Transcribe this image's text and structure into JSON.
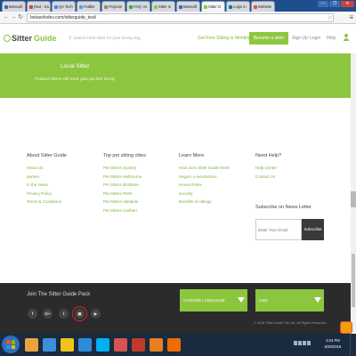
{
  "browser": {
    "tabs": [
      {
        "label": "Betasoft",
        "fav": "#3b6db0"
      },
      {
        "label": "(Nat - Gu",
        "fav": "#c9443a"
      },
      {
        "label": "QA Tech",
        "fav": "#4285f4"
      },
      {
        "label": "Fiddler",
        "fav": "#5b9bd5"
      },
      {
        "label": "Projects",
        "fav": "#888888"
      },
      {
        "label": "FAQ: Av",
        "fav": "#34a853"
      },
      {
        "label": "Sitter G",
        "fav": "#8cc63f"
      },
      {
        "label": "Betasoft",
        "fav": "#3b6db0"
      },
      {
        "label": "Sitter G",
        "fav": "#8cc63f",
        "active": true
      },
      {
        "label": "Login in",
        "fav": "#0077b5"
      },
      {
        "label": "Website",
        "fav": "#d9534f"
      }
    ],
    "url": "betasofsdev.com/sitterguide_test/",
    "window_buttons": {
      "minimize": "—",
      "maximize": "❐",
      "close": "✕"
    }
  },
  "header": {
    "logo_sitter": "Sitter",
    "logo_guide": "Guide",
    "search_placeholder": "Search here sitter for your loving dog",
    "get_free": "Get Free Sitting or Minding",
    "become_sitter": "Become a sitter",
    "sign_up": "Sign Up",
    "login": "Login",
    "help": "Help"
  },
  "hero": {
    "title": "Local Sitter",
    "subtitle": "Trusted sitters will treat your pet like family"
  },
  "footer": {
    "columns": [
      {
        "title": "About Sitter Guide",
        "items": [
          "About Us",
          "partner",
          "In the News",
          "Privacy Policy",
          "Terms & Conditions"
        ]
      },
      {
        "title": "Top pet sitting cities",
        "items": [
          "Pet Sitters Sydney",
          "Pet Sitters Melbourne",
          "Pet Sitters Brisbane",
          "Pet Sitters Perth",
          "Pet Sitters Adelaide",
          "Pet Sitters Canberr"
        ]
      },
      {
        "title": "Learn More",
        "items": [
          "How does Sitter Guide Work",
          "Seguro y reembolsos",
          "House Rules",
          "security",
          "Benefits of sittings"
        ]
      },
      {
        "title": "Need Help?",
        "items": [
          "Help Center",
          "Contact Us"
        ]
      }
    ],
    "subscribe_title": "Subscribe on News Letter",
    "email_placeholder": "Enter Your Email",
    "subscribe_button": "Subscribe"
  },
  "dark_footer": {
    "join": "Join The Sitter Guide Pack",
    "social": [
      "f",
      "G+",
      "t",
      "▣",
      "▶"
    ],
    "language_select": "CHOOSE LANGUAGE",
    "currency_select": "USD",
    "copyright": "© 2015 Sitter Guide Pty Ltd. All Rights Reserved"
  },
  "taskbar": {
    "time": "3:24 PM",
    "date": "5/30/2016",
    "icons": [
      "#e8a33d",
      "#3b8fd9",
      "#f0c419",
      "#2e8bd8",
      "#00aff0",
      "#d9534f",
      "#c0392b",
      "#e67e22",
      "#ef6c00"
    ]
  }
}
